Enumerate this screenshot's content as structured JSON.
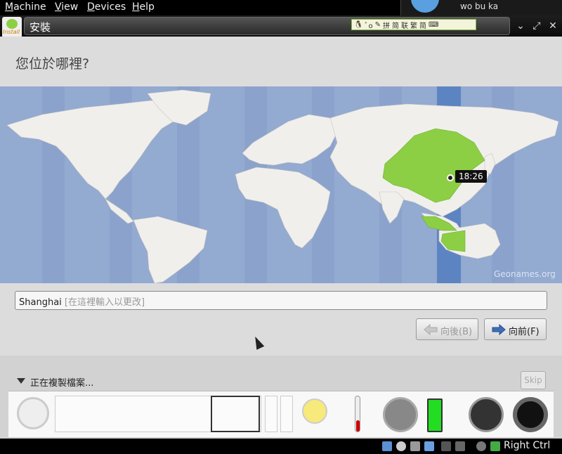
{
  "host_menu": [
    "Machine",
    "View",
    "Devices",
    "Help"
  ],
  "notification": {
    "text": "wo bu ka"
  },
  "window": {
    "title": "安裝",
    "app_icon_word": "Install"
  },
  "ime_bar": [
    "拼",
    "简",
    "联",
    "繁",
    "简"
  ],
  "page": {
    "question": "您位於哪裡?"
  },
  "map": {
    "time": "18:26",
    "attribution": "Geonames.org",
    "highlight_color": "#8ccf44",
    "ocean_color": "#93aad1"
  },
  "city": {
    "value": "Shanghai",
    "placeholder": "[在這裡輸入以更改]"
  },
  "nav": {
    "back_label": "向後(B)",
    "forward_label": "向前(F)"
  },
  "progress": {
    "label": "正在複製檔案..."
  },
  "skip_label": "Skip",
  "statusbar": {
    "host_key": "Right Ctrl"
  }
}
